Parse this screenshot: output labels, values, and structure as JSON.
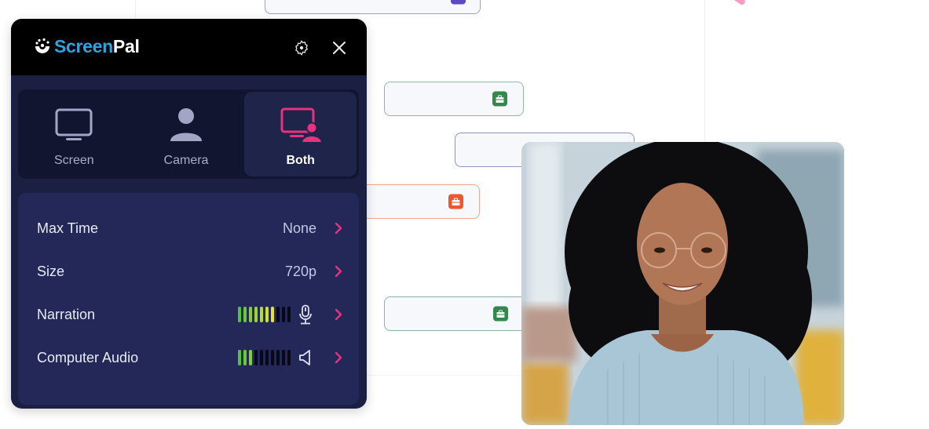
{
  "app": {
    "brand_part1": "Screen",
    "brand_part2": "Pal",
    "settings_icon": "gear-icon",
    "close_icon": "close-icon"
  },
  "modes": [
    {
      "label": "Screen",
      "icon": "monitor-icon",
      "selected": false
    },
    {
      "label": "Camera",
      "icon": "person-icon",
      "selected": false
    },
    {
      "label": "Both",
      "icon": "monitor-person-icon",
      "selected": true
    }
  ],
  "settings": {
    "max_time": {
      "label": "Max Time",
      "value": "None"
    },
    "size": {
      "label": "Size",
      "value": "720p"
    },
    "narration": {
      "label": "Narration",
      "level_segments_lit": 7,
      "level_segments_total": 10,
      "icon": "microphone-icon"
    },
    "computer_audio": {
      "label": "Computer Audio",
      "level_segments_lit": 3,
      "level_segments_total": 10,
      "icon": "speaker-icon"
    }
  },
  "colors": {
    "accent_pink": "#e8327f",
    "brand_blue": "#2ea3dd",
    "meter_green": "#52c23a",
    "meter_yellow": "#e4e62b",
    "badge_green": "#2f8a4b",
    "badge_orange": "#ee5631",
    "badge_purple": "#5a4bc4"
  },
  "background_cards": [
    {
      "color": "purple",
      "border": "#9aa0c8",
      "badge": "#5a4bc4"
    },
    {
      "color": "green",
      "border": "#8fb8a3",
      "badge": "#2f8a4b"
    },
    {
      "color": "blue",
      "border": "#8d95b8",
      "badge": null
    },
    {
      "color": "orange",
      "border": "#efa792",
      "badge": "#ee5631"
    },
    {
      "color": "green",
      "border": "#8fb3a0",
      "badge": "#2f8a4b"
    }
  ],
  "photo": {
    "description": "webcam-portrait"
  }
}
